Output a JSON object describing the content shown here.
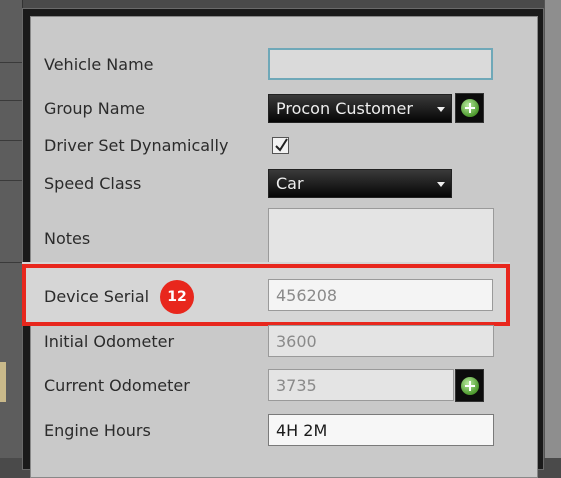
{
  "form": {
    "vehicle_name": {
      "label": "Vehicle Name",
      "value": ""
    },
    "group_name": {
      "label": "Group Name",
      "value": "Procon Customer"
    },
    "driver_set_dynamically": {
      "label": "Driver Set Dynamically",
      "checked": true
    },
    "speed_class": {
      "label": "Speed Class",
      "value": "Car"
    },
    "notes": {
      "label": "Notes",
      "value": ""
    },
    "device_serial": {
      "label": "Device Serial",
      "value": "456208"
    },
    "initial_odometer": {
      "label": "Initial Odometer",
      "value": "3600"
    },
    "current_odometer": {
      "label": "Current Odometer",
      "value": "3735"
    },
    "engine_hours": {
      "label": "Engine Hours",
      "value": "4H 2M"
    }
  },
  "annotation": {
    "badge_number": "12",
    "highlight_color": "#e8271d"
  },
  "icons": {
    "add_group": "plus-circle-icon",
    "add_odometer": "plus-circle-icon",
    "checkbox": "check-icon"
  }
}
